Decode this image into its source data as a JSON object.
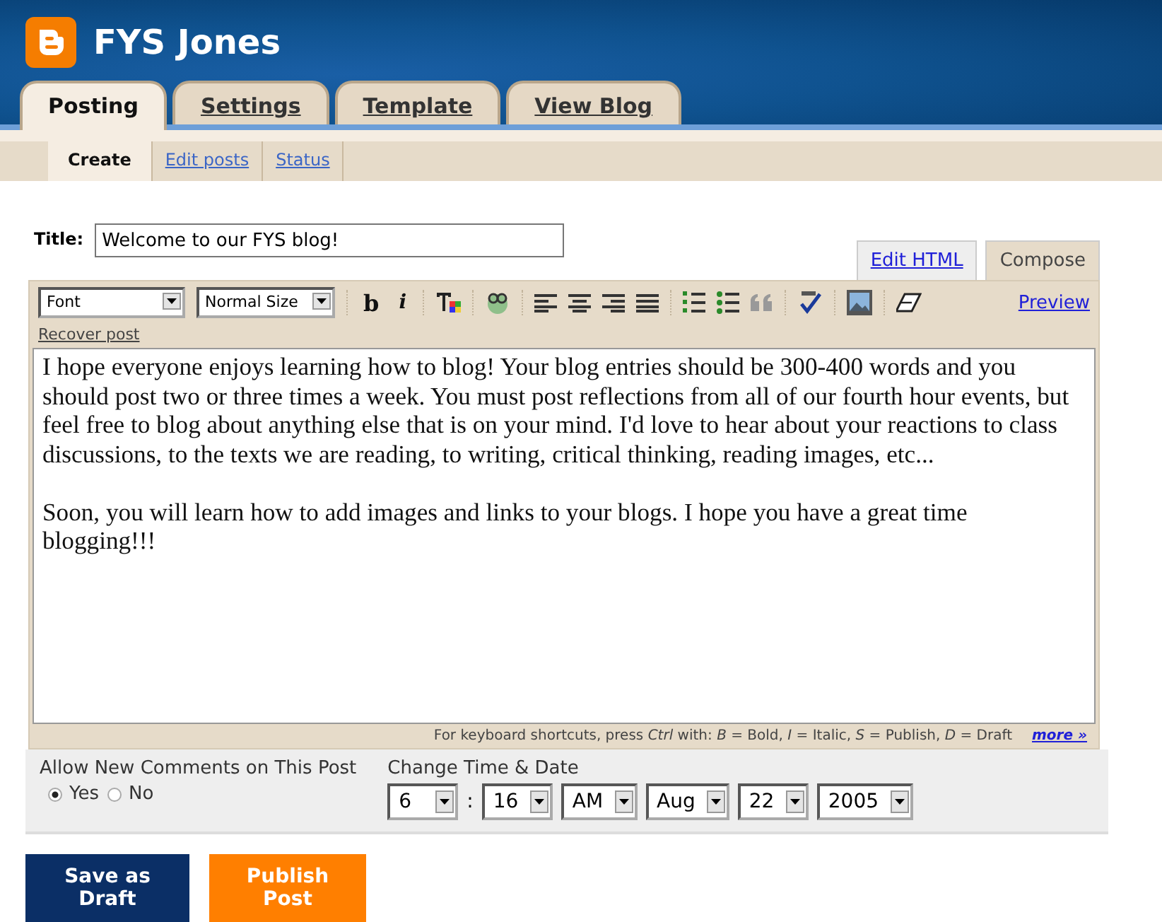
{
  "header": {
    "blog_title": "FYS Jones"
  },
  "tabs": [
    {
      "label": "Posting",
      "selected": true
    },
    {
      "label": "Settings",
      "selected": false
    },
    {
      "label": "Template",
      "selected": false
    },
    {
      "label": "View Blog",
      "selected": false
    }
  ],
  "subtabs": [
    {
      "label": "Create",
      "selected": true
    },
    {
      "label": "Edit posts",
      "selected": false
    },
    {
      "label": "Status",
      "selected": false
    }
  ],
  "title_field": {
    "label": "Title:",
    "value": "Welcome to our FYS blog!"
  },
  "editor_tabs": [
    {
      "label": "Edit HTML",
      "selected": false
    },
    {
      "label": "Compose",
      "selected": true
    }
  ],
  "toolbar": {
    "selects": [
      "Font",
      "Normal Size"
    ],
    "style_buttons": [
      {
        "label": "b",
        "kind": "bold"
      },
      {
        "label": "i",
        "kind": "italic"
      }
    ],
    "preview": "Preview",
    "recover": "Recover post"
  },
  "body": [
    "I hope everyone enjoys learning how to blog! Your blog entries should be 300-400 words and you should post two or three times a week. You must post reflections from all of our fourth hour events, but feel free to blog about anything else that is on your mind. I'd love to hear about your reactions to class discussions, to the texts we are reading, to writing, critical thinking, reading images, etc...",
    "Soon, you will learn how to add images and links to your blogs. I hope you have a great time blogging!!!"
  ],
  "shortcuts": {
    "text": "For keyboard shortcuts, press *Ctrl* with: *B* = Bold,  *I* = Italic,  *S* = Publish,  *D* = Draft",
    "more": "more »"
  },
  "comments": {
    "label": "Allow New Comments on This Post",
    "options": [
      {
        "label": "Yes",
        "selected": true
      },
      {
        "label": "No",
        "selected": false
      }
    ]
  },
  "time_date": {
    "label": "Change Time & Date",
    "separator": ":",
    "fields": [
      "6",
      "16",
      "AM",
      "Aug",
      "22",
      "2005"
    ]
  },
  "buttons": [
    {
      "label": "Save as Draft",
      "kind": "draft"
    },
    {
      "label": "Publish Post",
      "kind": "publish"
    }
  ]
}
